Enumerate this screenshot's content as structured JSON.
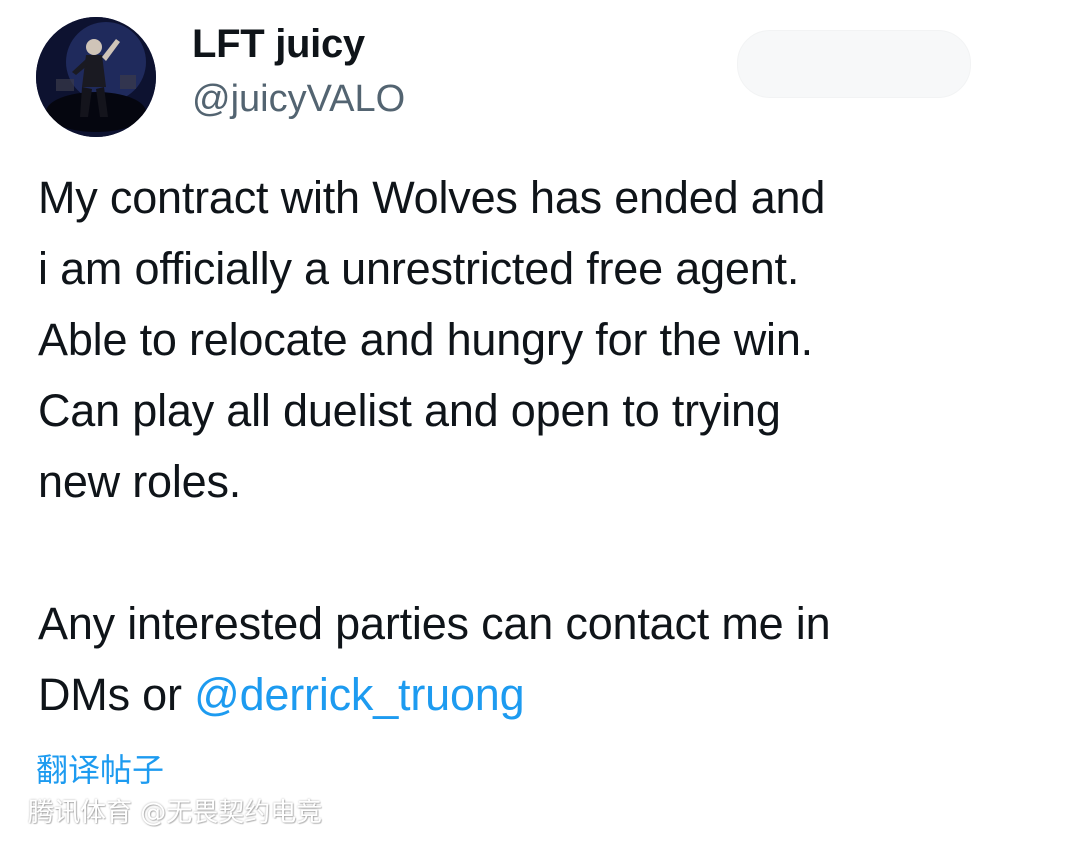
{
  "author": {
    "display_name": "LFT juicy",
    "handle": "@juicyVALO",
    "avatar_icon": "profile-photo"
  },
  "tweet": {
    "lines": [
      "My contract with Wolves has ended and",
      "i am officially a unrestricted free agent.",
      "Able to relocate and hungry for the win.",
      "Can play all duelist and open to trying",
      "new roles."
    ],
    "line_contact": "Any interested parties can contact me in",
    "line_dm_prefix": "DMs or ",
    "mention": "@derrick_truong"
  },
  "translate_label": "翻译帖子",
  "watermark": "腾讯体育 @无畏契约电竞",
  "colors": {
    "link": "#1d9bf0",
    "text": "#0f1419",
    "secondary": "#536471"
  }
}
